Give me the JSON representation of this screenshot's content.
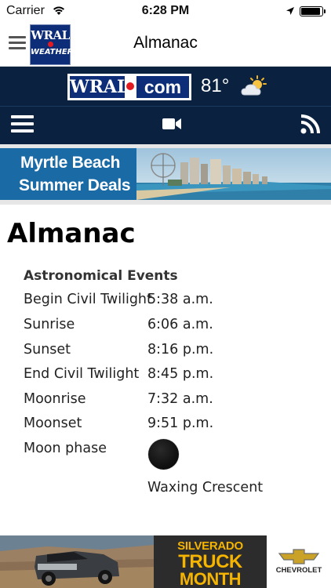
{
  "status_bar": {
    "carrier": "Carrier",
    "time": "6:28 PM",
    "battery_level": 0.95
  },
  "nav": {
    "title": "Almanac",
    "logo_line1": "WRAL",
    "logo_line2": "WEATHER",
    "menu_icon": "hamburger-icon"
  },
  "header": {
    "logo_left": "WRAL",
    "logo_right": "com",
    "temperature": "81°",
    "weather_icon": "partly-sunny-icon",
    "menu_icon": "hamburger-icon",
    "video_icon": "video-camera-icon",
    "rss_icon": "rss-icon"
  },
  "ad_top": {
    "line1": "Myrtle Beach",
    "line2": "Summer Deals"
  },
  "content": {
    "page_title": "Almanac",
    "section_title": "Astronomical Events",
    "events": [
      {
        "label": "Begin Civil Twilight",
        "value": "5:38 a.m."
      },
      {
        "label": "Sunrise",
        "value": "6:06 a.m."
      },
      {
        "label": "Sunset",
        "value": "8:16 p.m."
      },
      {
        "label": "End Civil Twilight",
        "value": "8:45 p.m."
      },
      {
        "label": "Moonrise",
        "value": "7:32 a.m."
      },
      {
        "label": "Moonset",
        "value": "9:51 p.m."
      }
    ],
    "moon_phase_label": "Moon phase",
    "moon_phase_value": "Waxing Crescent",
    "moon_icon": "moon-phase-icon"
  },
  "ad_bottom": {
    "promo_line1": "SILVERADO",
    "promo_line2": "TRUCK",
    "promo_line3": "MONTH",
    "brand": "CHEVROLET"
  },
  "colors": {
    "header_bg": "#0a2240",
    "logo_blue": "#0e2d78",
    "logo_red": "#e21b23",
    "promo_yellow": "#f5b400"
  }
}
